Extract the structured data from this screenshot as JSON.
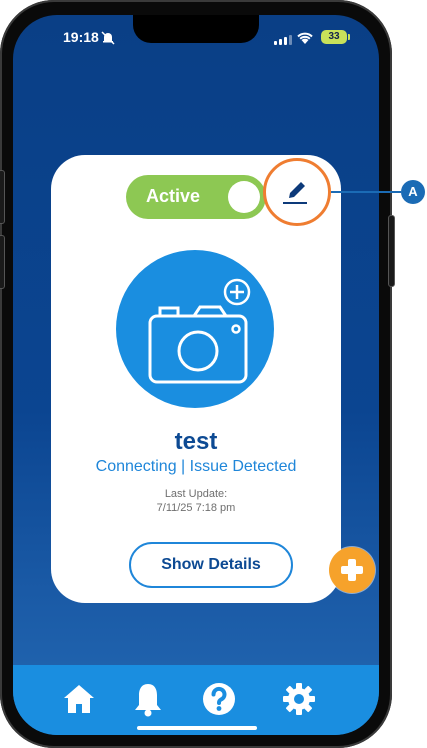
{
  "status_bar": {
    "time": "19:18",
    "battery": "33"
  },
  "card": {
    "toggle_label": "Active",
    "device_name": "test",
    "device_status": "Connecting | Issue Detected",
    "last_update_label": "Last Update:",
    "last_update_value": "7/11/25 7:18 pm",
    "details_button": "Show Details"
  },
  "tabbar": {
    "items": [
      "home",
      "notifications",
      "help",
      "settings"
    ]
  },
  "annotation": {
    "label": "A"
  },
  "colors": {
    "accent": "#1a8ee0",
    "active": "#8dc853",
    "fab": "#f6a22b",
    "navy": "#0d4a93",
    "callout": "#ef7d31"
  }
}
